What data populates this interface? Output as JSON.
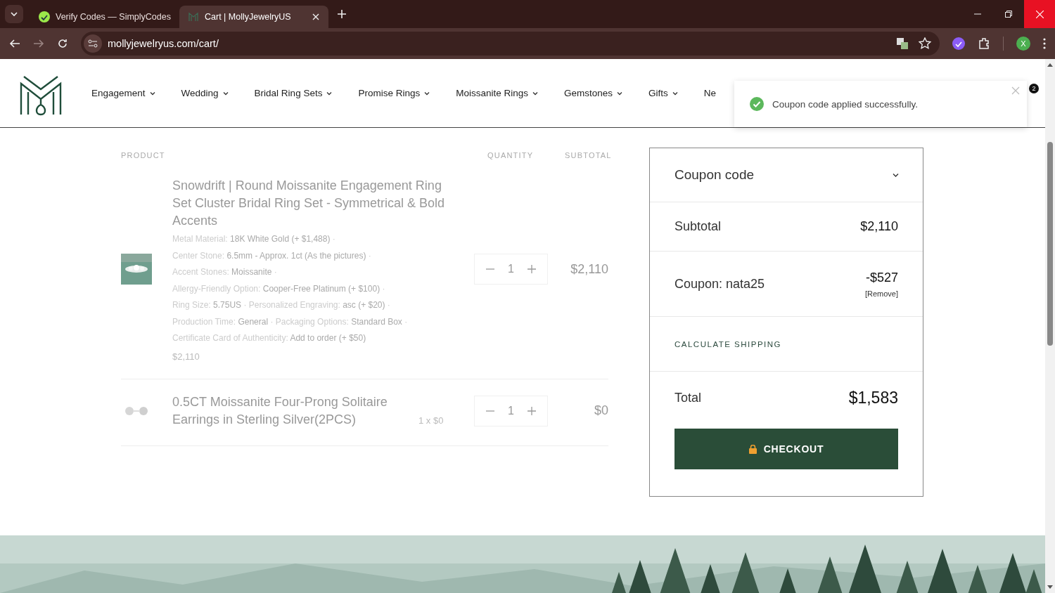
{
  "browser": {
    "tabs": [
      {
        "title": "Verify Codes — SimplyCodes",
        "selected": false
      },
      {
        "title": "Cart | MollyJewelryUS",
        "selected": true
      }
    ],
    "url": "mollyjewelryus.com/cart/",
    "profile": "X"
  },
  "nav": {
    "items": [
      {
        "label": "Engagement",
        "caret": true
      },
      {
        "label": "Wedding",
        "caret": true
      },
      {
        "label": "Bridal Ring Sets",
        "caret": true
      },
      {
        "label": "Promise Rings",
        "caret": true
      },
      {
        "label": "Moissanite Rings",
        "caret": true
      },
      {
        "label": "Gemstones",
        "caret": true
      },
      {
        "label": "Gifts",
        "caret": true
      },
      {
        "label": "Ne",
        "caret": false
      }
    ],
    "cart_count": "2"
  },
  "toast": {
    "message": "Coupon code applied successfully."
  },
  "cart": {
    "columns": [
      "PRODUCT",
      "QUANTITY",
      "SUBTOTAL"
    ],
    "separator": "·",
    "items": [
      {
        "name": "Snowdrift | Round Moissanite Engagement Ring Set Cluster Bridal Ring Set - Symmetrical & Bold Accents",
        "options": [
          {
            "label": "Metal Material:",
            "value": "18K White Gold (+ $1,488)"
          },
          {
            "label": "Center Stone:",
            "value": "6.5mm - Approx. 1ct (As the pictures)"
          },
          {
            "label": "Accent Stones:",
            "value": "Moissanite"
          },
          {
            "label": "Allergy-Friendly Option:",
            "value": "Cooper-Free Platinum (+ $100)"
          },
          {
            "label": "Ring Size:",
            "value": "5.75US"
          },
          {
            "label": "Personalized Engraving:",
            "value": "asc (+ $20)"
          },
          {
            "label": "Production Time:",
            "value": "General"
          },
          {
            "label": "Packaging Options:",
            "value": "Standard Box"
          },
          {
            "label": "Certificate Card of Authenticity:",
            "value": "Add to order (+ $50)"
          }
        ],
        "price": "$2,110",
        "quantity": "1",
        "subtotal": "$2,110"
      },
      {
        "name": "0.5CT Moissanite Four-Prong Solitaire Earrings in Sterling Silver(2PCS)",
        "unit_note": "1 x $0",
        "quantity": "1",
        "subtotal": "$0"
      }
    ]
  },
  "summary": {
    "coupon_toggle": "Coupon code",
    "subtotal_label": "Subtotal",
    "subtotal": "$2,110",
    "coupon_label": "Coupon: nata25",
    "coupon_amount": "-$527",
    "remove": "[Remove]",
    "shipping": "CALCULATE SHIPPING",
    "total_label": "Total",
    "total": "$1,583",
    "checkout": "CHECKOUT"
  }
}
